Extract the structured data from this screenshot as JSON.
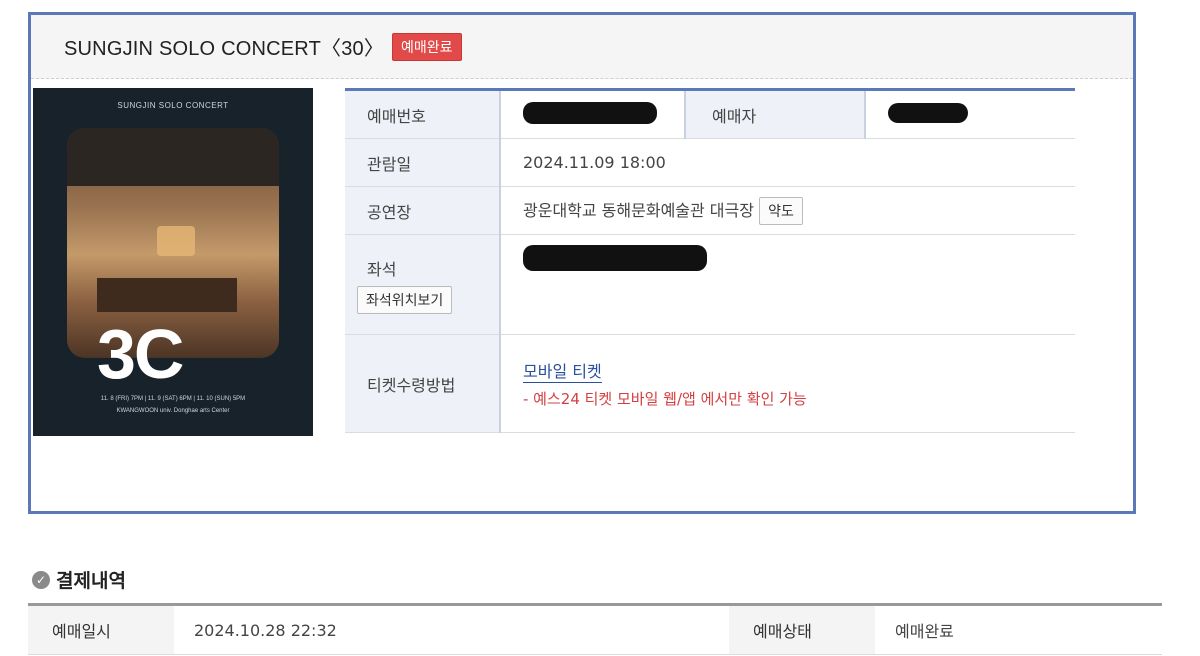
{
  "ticket": {
    "title": "SUNGJIN SOLO CONCERT〈30〉",
    "status_badge": "예매완료"
  },
  "poster": {
    "top_text": "SUNGJIN SOLO CONCERT",
    "big_text": "3C",
    "dates_text": "11. 8 (FRI) 7PM  |  11. 9 (SAT) 6PM  |  11. 10 (SUN) 5PM",
    "venue_text": "KWANGWOON univ. Donghae arts Center"
  },
  "info": {
    "booking_number_label": "예매번호",
    "booker_label": "예매자",
    "date_label": "관람일",
    "date_value": "2024.11.09 18:00",
    "venue_label": "공연장",
    "venue_value": "광운대학교 동해문화예술관 대극장",
    "map_button": "약도",
    "seat_label": "좌석",
    "seat_button": "좌석위치보기",
    "delivery_label": "티켓수령방법",
    "delivery_link": "모바일 티켓",
    "delivery_note": "- 예스24 티켓 모바일 웹/앱 에서만 확인 가능"
  },
  "payment": {
    "section_title": "결제내역",
    "icon": "check-circle-icon",
    "booked_at_label": "예매일시",
    "booked_at_value": "2024.10.28 22:32",
    "status_label": "예매상태",
    "status_value": "예매완료"
  },
  "colors": {
    "accent_blue": "#5b78b8",
    "badge_red": "#e24a4a",
    "note_red": "#d44040"
  }
}
